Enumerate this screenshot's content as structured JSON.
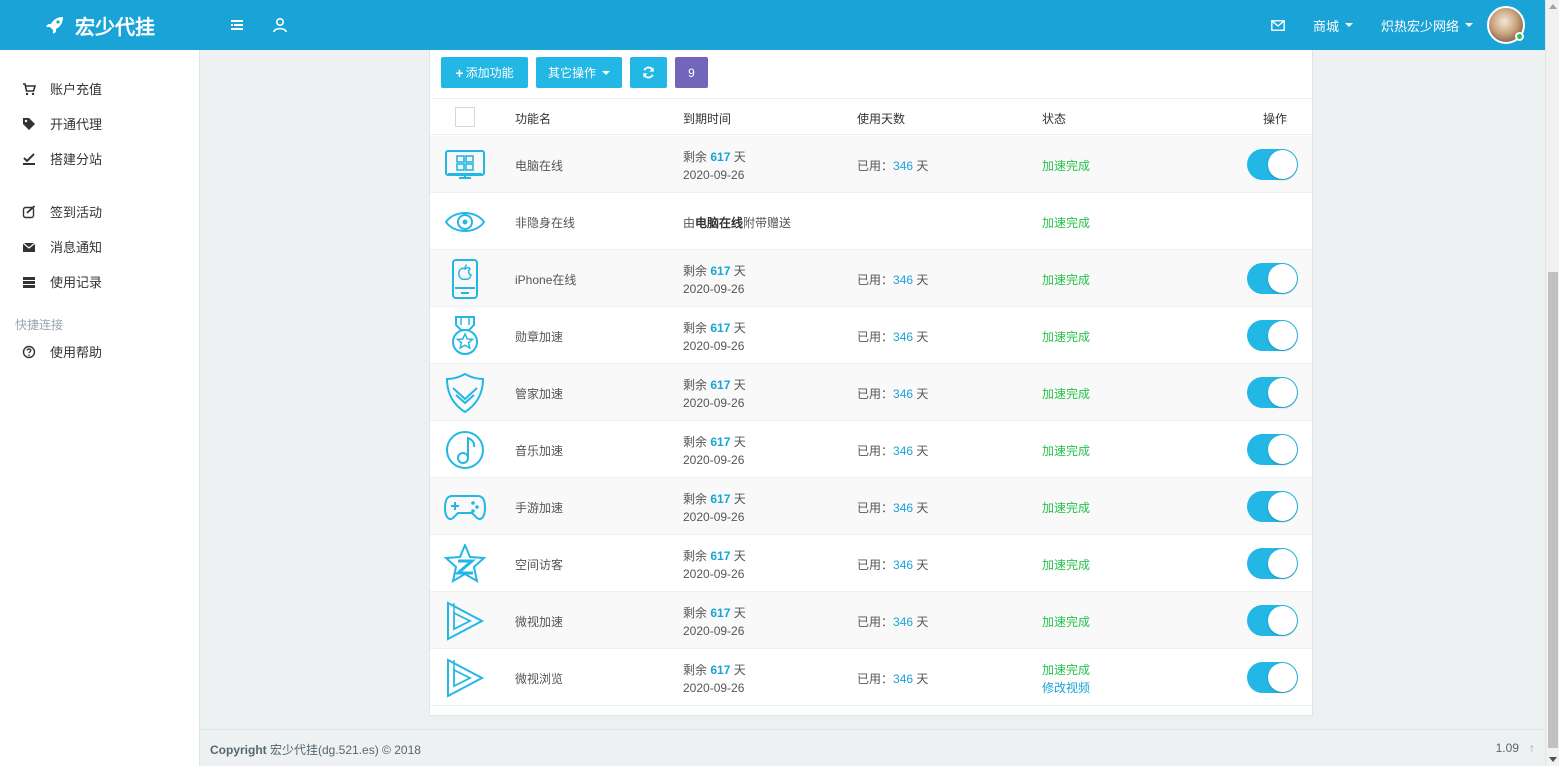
{
  "header": {
    "brand": "宏少代挂",
    "menu_mall": "商城",
    "menu_user": "炽热宏少网络"
  },
  "sidebar": {
    "items": [
      {
        "label": "账户充值",
        "icon": "cart-icon"
      },
      {
        "label": "开通代理",
        "icon": "tags-icon"
      },
      {
        "label": "搭建分站",
        "icon": "check-icon"
      },
      {
        "label": "签到活动",
        "icon": "edit-icon"
      },
      {
        "label": "消息通知",
        "icon": "envelope-icon"
      },
      {
        "label": "使用记录",
        "icon": "server-icon"
      }
    ],
    "section_header": "快捷连接",
    "help": {
      "label": "使用帮助",
      "icon": "question-circle-icon"
    }
  },
  "toolbar": {
    "add_label": "添加功能",
    "other_label": "其它操作",
    "count": "9"
  },
  "table": {
    "headers": {
      "name": "功能名",
      "expire": "到期时间",
      "days": "使用天数",
      "status": "状态",
      "action": "操作"
    },
    "remaining_prefix": "剩余",
    "days_unit": "天",
    "used_prefix": "已用：",
    "rows": [
      {
        "icon": "computer-icon",
        "name": "电脑在线",
        "remaining": "617",
        "date": "2020-09-26",
        "used": "346",
        "status": "加速完成",
        "enabled": true
      },
      {
        "icon": "eye-icon",
        "name": "非隐身在线",
        "gift_prefix": "由",
        "gift_bold": "电脑在线",
        "gift_suffix": "附带赠送",
        "status": "加速完成"
      },
      {
        "icon": "iphone-icon",
        "name": "iPhone在线",
        "remaining": "617",
        "date": "2020-09-26",
        "used": "346",
        "status": "加速完成",
        "enabled": true
      },
      {
        "icon": "medal-icon",
        "name": "勋章加速",
        "remaining": "617",
        "date": "2020-09-26",
        "used": "346",
        "status": "加速完成",
        "enabled": true
      },
      {
        "icon": "shield-icon",
        "name": "管家加速",
        "remaining": "617",
        "date": "2020-09-26",
        "used": "346",
        "status": "加速完成",
        "enabled": true
      },
      {
        "icon": "music-icon",
        "name": "音乐加速",
        "remaining": "617",
        "date": "2020-09-26",
        "used": "346",
        "status": "加速完成",
        "enabled": true
      },
      {
        "icon": "gamepad-icon",
        "name": "手游加速",
        "remaining": "617",
        "date": "2020-09-26",
        "used": "346",
        "status": "加速完成",
        "enabled": true
      },
      {
        "icon": "qzone-star-icon",
        "name": "空间访客",
        "remaining": "617",
        "date": "2020-09-26",
        "used": "346",
        "status": "加速完成",
        "enabled": true
      },
      {
        "icon": "play-icon",
        "name": "微视加速",
        "remaining": "617",
        "date": "2020-09-26",
        "used": "346",
        "status": "加速完成",
        "enabled": true
      },
      {
        "icon": "play-icon",
        "name": "微视浏览",
        "remaining": "617",
        "date": "2020-09-26",
        "used": "346",
        "status": "加速完成",
        "status_link": "修改视频",
        "enabled": true
      }
    ]
  },
  "footer": {
    "copyright_bold": "Copyright",
    "copyright_text": " 宏少代挂(dg.521.es) © 2018",
    "version": "1.09",
    "back_to_top": "↑"
  },
  "colors": {
    "header": "#1aa3d6",
    "accent": "#23b7e5",
    "success": "#27c24c",
    "purple": "#7266ba"
  }
}
